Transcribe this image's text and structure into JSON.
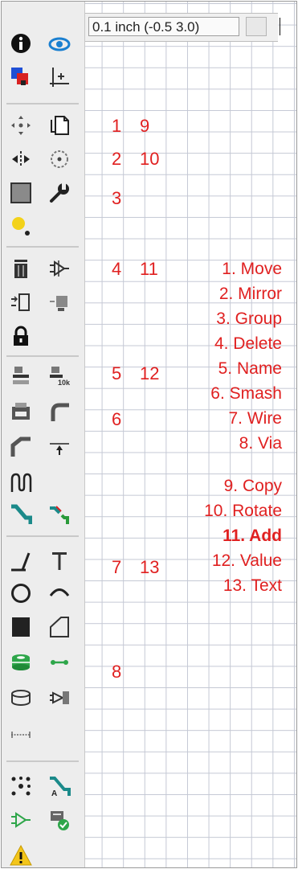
{
  "coordinate_display": {
    "value": "0.1 inch (-0.5 3.0)"
  },
  "toolbar": {
    "icons": [
      "info-icon",
      "show-icon",
      "display-layers-icon",
      "mark-icon",
      "move-icon",
      "copy-icon",
      "mirror-icon",
      "rotate-icon",
      "group-icon",
      "change-icon",
      "paste-icon",
      "delete-icon",
      "add-icon",
      "pinswap-icon",
      "replace-icon",
      "lock-icon",
      "name-icon",
      "value-icon",
      "smash-icon",
      "miter-icon",
      "split-icon",
      "optimize-icon",
      "meander-icon",
      "route-icon",
      "ripup-icon",
      "wire-icon",
      "text-icon",
      "circle-icon",
      "arc-icon",
      "rect-icon",
      "polygon-icon",
      "via-icon",
      "signal-icon",
      "hole-icon",
      "attribute-icon",
      "dimension-icon",
      "ratsnest-icon",
      "autorouter-icon",
      "ercc-icon",
      "drc-icon",
      "errors-icon"
    ]
  },
  "annotations": {
    "numbers": [
      "1",
      "9",
      "2",
      "10",
      "3",
      "4",
      "11",
      "5",
      "12",
      "6",
      "7",
      "13",
      "8"
    ],
    "legend": [
      "1. Move",
      "2. Mirror",
      "3. Group",
      "4. Delete",
      "5. Name",
      "6. Smash",
      "7. Wire",
      "8. Via",
      "9. Copy",
      "10. Rotate",
      "11. Add",
      "12. Value",
      "13. Text"
    ]
  },
  "colors": {
    "annotation_red": "#e02020",
    "toolbar_bg": "#ededed",
    "grid_line": "#c4c8d4"
  }
}
